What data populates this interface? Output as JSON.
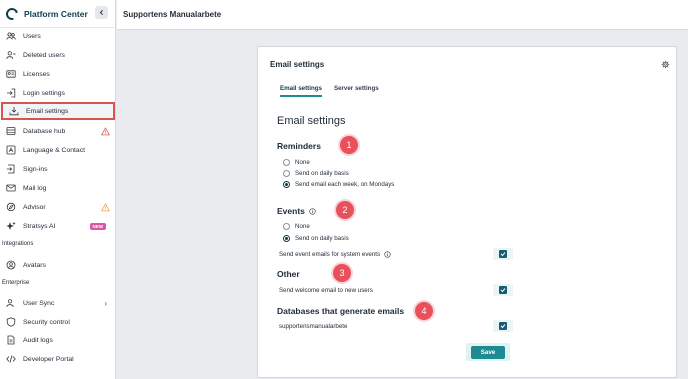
{
  "brand": {
    "name": "Platform Center"
  },
  "header": {
    "title": "Supportens Manualarbete"
  },
  "sidebar": {
    "items": [
      {
        "label": "Users",
        "icon": "users-icon"
      },
      {
        "label": "Deleted users",
        "icon": "user-minus-icon"
      },
      {
        "label": "Licenses",
        "icon": "license-icon"
      },
      {
        "label": "Login settings",
        "icon": "login-icon"
      },
      {
        "label": "Email settings",
        "icon": "download-tray-icon"
      },
      {
        "label": "Database hub",
        "icon": "database-icon"
      },
      {
        "label": "Language & Contact",
        "icon": "language-icon"
      },
      {
        "label": "Sign-ins",
        "icon": "sign-in-icon"
      },
      {
        "label": "Mail log",
        "icon": "mail-icon"
      },
      {
        "label": "Advisor",
        "icon": "advisor-icon"
      },
      {
        "label": "Stratsys AI",
        "icon": "sparkle-icon"
      }
    ],
    "new_badge": "NEW",
    "integrations_label": "Integrations",
    "integrations_items": [
      {
        "label": "Avatars",
        "icon": "avatar-icon"
      }
    ],
    "enterprise_label": "Enterprise",
    "enterprise_items": [
      {
        "label": "User Sync",
        "icon": "user-sync-icon"
      },
      {
        "label": "Security control",
        "icon": "shield-icon"
      },
      {
        "label": "Audit logs",
        "icon": "document-icon"
      },
      {
        "label": "Developer Portal",
        "icon": "code-icon"
      }
    ]
  },
  "card": {
    "title": "Email settings",
    "tabs": [
      "Email settings",
      "Server settings"
    ],
    "heading": "Email settings",
    "reminders": {
      "title": "Reminders",
      "options": [
        "None",
        "Send on daily basis",
        "Send email each week, on Mondays"
      ],
      "selected": "Send email each week, on Mondays"
    },
    "events": {
      "title": "Events",
      "options": [
        "None",
        "Send on daily basis"
      ],
      "selected": "Send on daily basis",
      "system_events_label": "Send event emails for system events"
    },
    "other": {
      "title": "Other",
      "welcome_label": "Send welcome email to new users"
    },
    "databases": {
      "title": "Databases that generate emails",
      "items": [
        "supportensmanualarbete"
      ]
    },
    "save_label": "Save"
  },
  "markers": [
    "1",
    "2",
    "3",
    "4"
  ],
  "colors": {
    "accent": "#1f8a93",
    "brand": "#0f3d4c",
    "marker": "#e8505b",
    "highlight": "#d9534f",
    "new_badge": "#d957a6"
  }
}
